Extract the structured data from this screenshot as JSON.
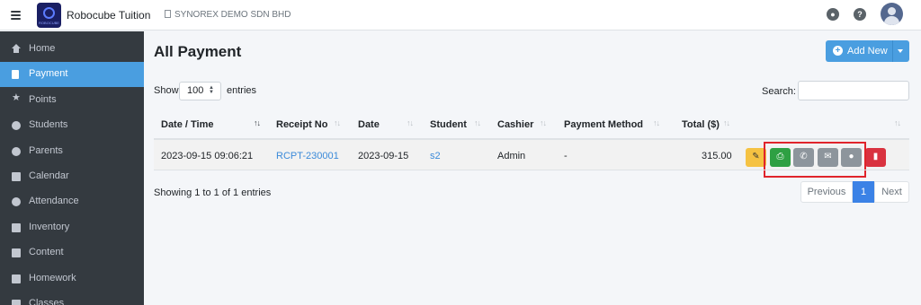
{
  "header": {
    "brand": "Robocube Tuition",
    "logo_text": "ROBOCUBE",
    "company": "SYNOREX DEMO SDN BHD"
  },
  "sidebar": {
    "items": [
      {
        "label": "Home",
        "icon": "home-icon"
      },
      {
        "label": "Payment",
        "icon": "file-icon",
        "active": true
      },
      {
        "label": "Points",
        "icon": "star-icon"
      },
      {
        "label": "Students",
        "icon": "users-icon"
      },
      {
        "label": "Parents",
        "icon": "user-circle-icon"
      },
      {
        "label": "Calendar",
        "icon": "calendar-icon"
      },
      {
        "label": "Attendance",
        "icon": "clock-icon"
      },
      {
        "label": "Inventory",
        "icon": "truck-icon"
      },
      {
        "label": "Content",
        "icon": "megaphone-icon"
      },
      {
        "label": "Homework",
        "icon": "book-icon"
      },
      {
        "label": "Classes",
        "icon": "classes-icon"
      }
    ]
  },
  "main": {
    "title": "All Payment",
    "add_label": "Add New",
    "show_label": "Show",
    "page_length": "100",
    "entries_label": "entries",
    "search_label": "Search:",
    "search_value": "",
    "columns": [
      "Date / Time",
      "Receipt No",
      "Date",
      "Student",
      "Cashier",
      "Payment Method",
      "Total ($)",
      ""
    ],
    "rows": [
      {
        "datetime": "2023-09-15 09:06:21",
        "receipt": "RCPT-230001",
        "date": "2023-09-15",
        "student": "s2",
        "cashier": "Admin",
        "method": "-",
        "total": "315.00"
      }
    ],
    "info": "Showing 1 to 1 of 1 entries",
    "pagination": {
      "previous": "Previous",
      "page": "1",
      "next": "Next"
    }
  },
  "colors": {
    "accent": "#4a9ee0",
    "sidebar_bg": "#343a40",
    "edit": "#f5c242",
    "print": "#2ea043",
    "delete": "#d9323f",
    "highlight": "#e0242b"
  }
}
